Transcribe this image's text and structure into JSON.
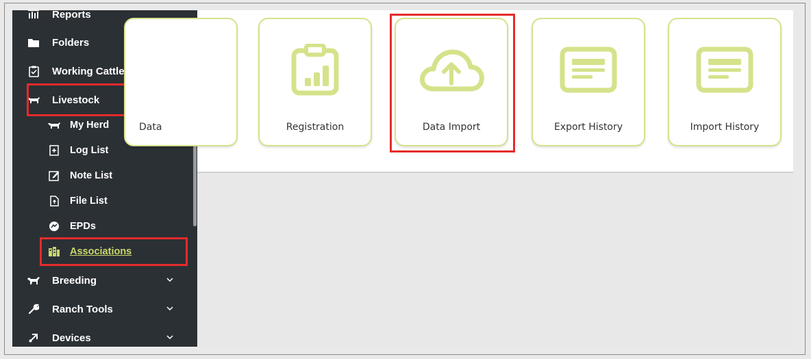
{
  "sidebar": {
    "items": [
      {
        "label": "Reports",
        "icon": "reports-icon",
        "chevron": false
      },
      {
        "label": "Folders",
        "icon": "folder-icon",
        "chevron": true
      },
      {
        "label": "Working Cattle",
        "icon": "clipboard-check-icon",
        "chevron": true
      },
      {
        "label": "Livestock",
        "icon": "cow-icon",
        "chevron": true,
        "expanded": true
      },
      {
        "label": "Breeding",
        "icon": "breeding-icon",
        "chevron": true
      },
      {
        "label": "Ranch Tools",
        "icon": "wrench-icon",
        "chevron": true
      },
      {
        "label": "Devices",
        "icon": "device-icon",
        "chevron": true
      }
    ],
    "livestock_sub": [
      {
        "label": "My Herd",
        "icon": "cow-icon"
      },
      {
        "label": "Log List",
        "icon": "log-icon"
      },
      {
        "label": "Note List",
        "icon": "edit-note-icon"
      },
      {
        "label": "File List",
        "icon": "file-icon"
      },
      {
        "label": "EPDs",
        "icon": "epd-icon"
      },
      {
        "label": "Associations",
        "icon": "associations-icon",
        "active": true
      }
    ]
  },
  "cards": [
    {
      "label": "Data",
      "icon": "data-icon"
    },
    {
      "label": "Registration",
      "icon": "registration-chart-icon"
    },
    {
      "label": "Data Import",
      "icon": "cloud-upload-icon"
    },
    {
      "label": "Export History",
      "icon": "export-history-icon"
    },
    {
      "label": "Import History",
      "icon": "import-history-icon"
    }
  ],
  "colors": {
    "accent": "#d6e28a",
    "active_link": "#c8d86a",
    "sidebar_bg": "#2b3035",
    "highlight": "#e52b2b"
  }
}
